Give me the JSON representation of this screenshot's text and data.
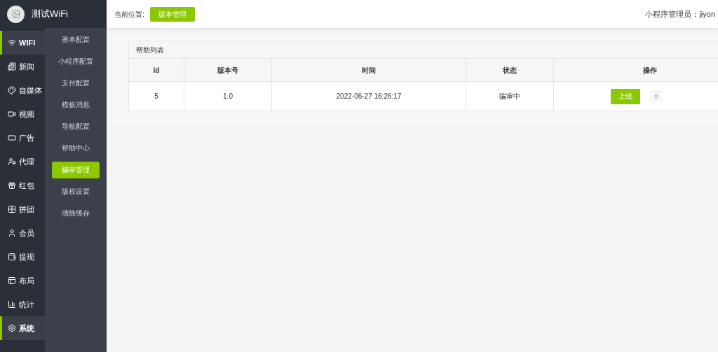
{
  "brand": {
    "name": "测试WiFi"
  },
  "main_menu": [
    {
      "label": "WIFI",
      "selected": true
    },
    {
      "label": "新闻",
      "selected": false
    },
    {
      "label": "自媒体",
      "selected": false
    },
    {
      "label": "视频",
      "selected": false
    },
    {
      "label": "广告",
      "selected": false
    },
    {
      "label": "代理",
      "selected": false
    },
    {
      "label": "红包",
      "selected": false
    },
    {
      "label": "拼团",
      "selected": false
    },
    {
      "label": "会员",
      "selected": false
    },
    {
      "label": "提现",
      "selected": false
    },
    {
      "label": "布局",
      "selected": false
    },
    {
      "label": "统计",
      "selected": false
    },
    {
      "label": "系统",
      "selected": true
    }
  ],
  "sub_menu": [
    {
      "label": "基本配置",
      "selected": false
    },
    {
      "label": "小程序配置",
      "selected": false
    },
    {
      "label": "支付配置",
      "selected": false
    },
    {
      "label": "模板消息",
      "selected": false
    },
    {
      "label": "导航配置",
      "selected": false
    },
    {
      "label": "帮助中心",
      "selected": false
    },
    {
      "label": "骗审管理",
      "selected": true
    },
    {
      "label": "版权设置",
      "selected": false
    },
    {
      "label": "清除缓存",
      "selected": false
    }
  ],
  "header": {
    "breadcrumb_label": "当前位置:",
    "breadcrumb_button": "版本管理",
    "admin_label": "小程序管理员：",
    "admin_name": "jiyon"
  },
  "panel": {
    "title": "帮助列表",
    "table": {
      "columns": [
        "id",
        "版本号",
        "时间",
        "状态",
        "操作"
      ],
      "rows": [
        {
          "id": "5",
          "version": "1.0",
          "time": "2022-06-27 16:26:17",
          "status": "骗审中",
          "action": "上线"
        }
      ]
    }
  }
}
